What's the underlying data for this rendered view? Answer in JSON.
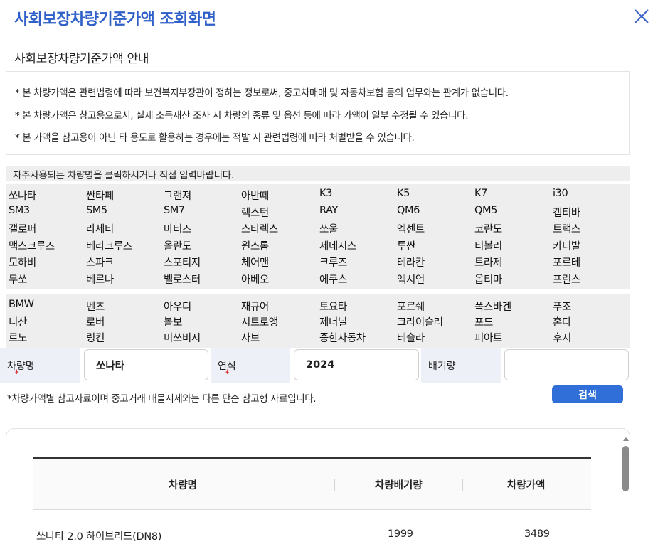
{
  "header": {
    "title": "사회보장차량기준가액 조회화면"
  },
  "section": {
    "title": "사회보장차량기준가액 안내"
  },
  "notices": [
    "* 본 차량가액은 관련법령에 따라 보건복지부장관이 정하는 정보로써, 중고차매매 및 자동차보험 등의 업무와는 관계가 없습니다.",
    "* 본 차량가액은 참고용으로서, 실제 소득재산 조사 시 차량의 종류 및 옵션 등에 따라 가액이 일부 수정될 수 있습니다.",
    "* 본 가액을 참고용이 아닌 타 용도로 활용하는 경우에는 적발 시 관련법령에 따라 처벌받을 수 있습니다."
  ],
  "hint": "자주사용되는 차량명을 클릭하시거나 직접 입력바랍니다.",
  "domestic_cars": [
    "쏘나타",
    "싼타페",
    "그랜져",
    "아반떼",
    "K3",
    "K5",
    "K7",
    "i30",
    "SM3",
    "SM5",
    "SM7",
    "렉스턴",
    "RAY",
    "QM6",
    "QM5",
    "캡티바",
    "갤로퍼",
    "라세티",
    "마티즈",
    "스타렉스",
    "쏘울",
    "엑센트",
    "코란도",
    "트랙스",
    "맥스크루즈",
    "베라크루즈",
    "올란도",
    "윈스톰",
    "제네시스",
    "투싼",
    "티볼리",
    "카니발",
    "모하비",
    "스파크",
    "스포티지",
    "체어맨",
    "크루즈",
    "테라칸",
    "트라제",
    "포르테",
    "무쏘",
    "베르나",
    "벨로스터",
    "아베오",
    "에쿠스",
    "엑시언",
    "옵티마",
    "프린스"
  ],
  "import_cars": [
    "BMW",
    "벤츠",
    "아우디",
    "재규어",
    "토요타",
    "포르쉐",
    "폭스바겐",
    "푸조",
    "니산",
    "로버",
    "볼보",
    "시트로앵",
    "제너널",
    "크라이슬러",
    "포드",
    "혼다",
    "르노",
    "링컨",
    "미쓰비시",
    "사브",
    "중한자동차",
    "테슬라",
    "피아트",
    "후지"
  ],
  "form": {
    "car_name_label": "차량명",
    "car_name_value": "쏘나타",
    "year_label": "연식",
    "year_value": "2024",
    "displacement_label": "배기량",
    "displacement_value": "",
    "required_mark": "*"
  },
  "disclaimer": "*차량가액별 참고자료이며 중고거래 매물시세와는 다른 단순 참고형 자료입니다.",
  "search_label": "검색",
  "table": {
    "headers": [
      "차량명",
      "차량배기량",
      "차량가액"
    ],
    "rows": [
      {
        "name": "쏘나타 2.0 하이브리드(DN8)",
        "displacement": "1999",
        "price": "3489"
      }
    ]
  }
}
